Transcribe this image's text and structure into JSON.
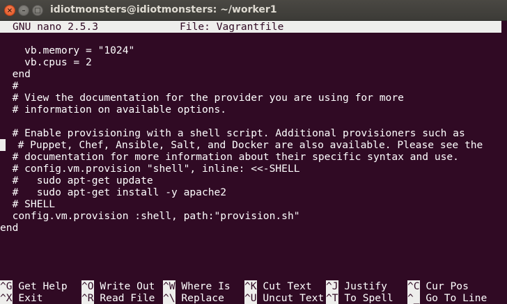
{
  "window": {
    "title": "idiotmonsters@idiotmonsters: ~/worker1",
    "close_glyph": "×",
    "minimize_glyph": "–",
    "maximize_glyph": "□"
  },
  "nano": {
    "version": "GNU nano 2.5.3",
    "file_label": "File: Vagrantfile"
  },
  "editor": {
    "lines": [
      "    vb.memory = \"1024\"",
      "    vb.cpus = 2",
      "  end",
      "  #",
      "  # View the documentation for the provider you are using for more",
      "  # information on available options.",
      "",
      "  # Enable provisioning with a shell script. Additional provisioners such as",
      "  # Puppet, Chef, Ansible, Salt, and Docker are also available. Please see the",
      "  # documentation for more information about their specific syntax and use.",
      "  # config.vm.provision \"shell\", inline: <<-SHELL",
      "  #   sudo apt-get update",
      "  #   sudo apt-get install -y apache2",
      "  # SHELL",
      "  config.vm.provision :shell, path:\"provision.sh\"",
      "end"
    ]
  },
  "shortcuts": [
    {
      "key": "^G",
      "label": "Get Help"
    },
    {
      "key": "^O",
      "label": "Write Out"
    },
    {
      "key": "^W",
      "label": "Where Is"
    },
    {
      "key": "^K",
      "label": "Cut Text"
    },
    {
      "key": "^J",
      "label": "Justify"
    },
    {
      "key": "^C",
      "label": "Cur Pos"
    },
    {
      "key": "^X",
      "label": "Exit"
    },
    {
      "key": "^R",
      "label": "Read File"
    },
    {
      "key": "^\\",
      "label": "Replace"
    },
    {
      "key": "^U",
      "label": "Uncut Text"
    },
    {
      "key": "^T",
      "label": "To Spell"
    },
    {
      "key": "^_",
      "label": "Go To Line"
    }
  ]
}
